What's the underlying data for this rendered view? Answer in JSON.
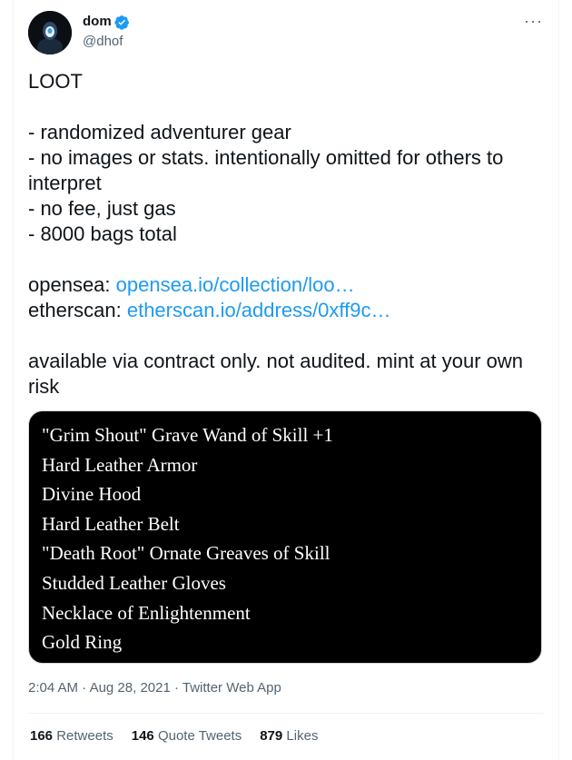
{
  "author": {
    "display_name": "dom",
    "handle": "@dhof",
    "verified_icon": "verified-badge-icon"
  },
  "more_icon": "more-options-icon",
  "tweet": {
    "title": "LOOT",
    "bullets": [
      "- randomized adventurer gear",
      "- no images or stats. intentionally omitted for others to interpret",
      "- no fee, just gas",
      "- 8000 bags total"
    ],
    "opensea_label": "opensea: ",
    "opensea_link": "opensea.io/collection/loo…",
    "etherscan_label": "etherscan: ",
    "etherscan_link": "etherscan.io/address/0xff9c…",
    "disclaimer": "available via contract only. not audited. mint at your own risk"
  },
  "media": {
    "items": [
      "\"Grim Shout\" Grave Wand of Skill +1",
      "Hard Leather Armor",
      "Divine Hood",
      "Hard Leather Belt",
      "\"Death Root\" Ornate Greaves of Skill",
      "Studded Leather Gloves",
      "Necklace of Enlightenment",
      "Gold Ring"
    ]
  },
  "meta": {
    "time": "2:04 AM",
    "separator": " · ",
    "date": "Aug 28, 2021",
    "source": "Twitter Web App"
  },
  "stats": {
    "retweets_count": "166",
    "retweets_label": "Retweets",
    "quotes_count": "146",
    "quotes_label": "Quote Tweets",
    "likes_count": "879",
    "likes_label": "Likes"
  },
  "colors": {
    "link": "#1d9bf0",
    "text": "#0f1419",
    "secondary": "#536471"
  }
}
